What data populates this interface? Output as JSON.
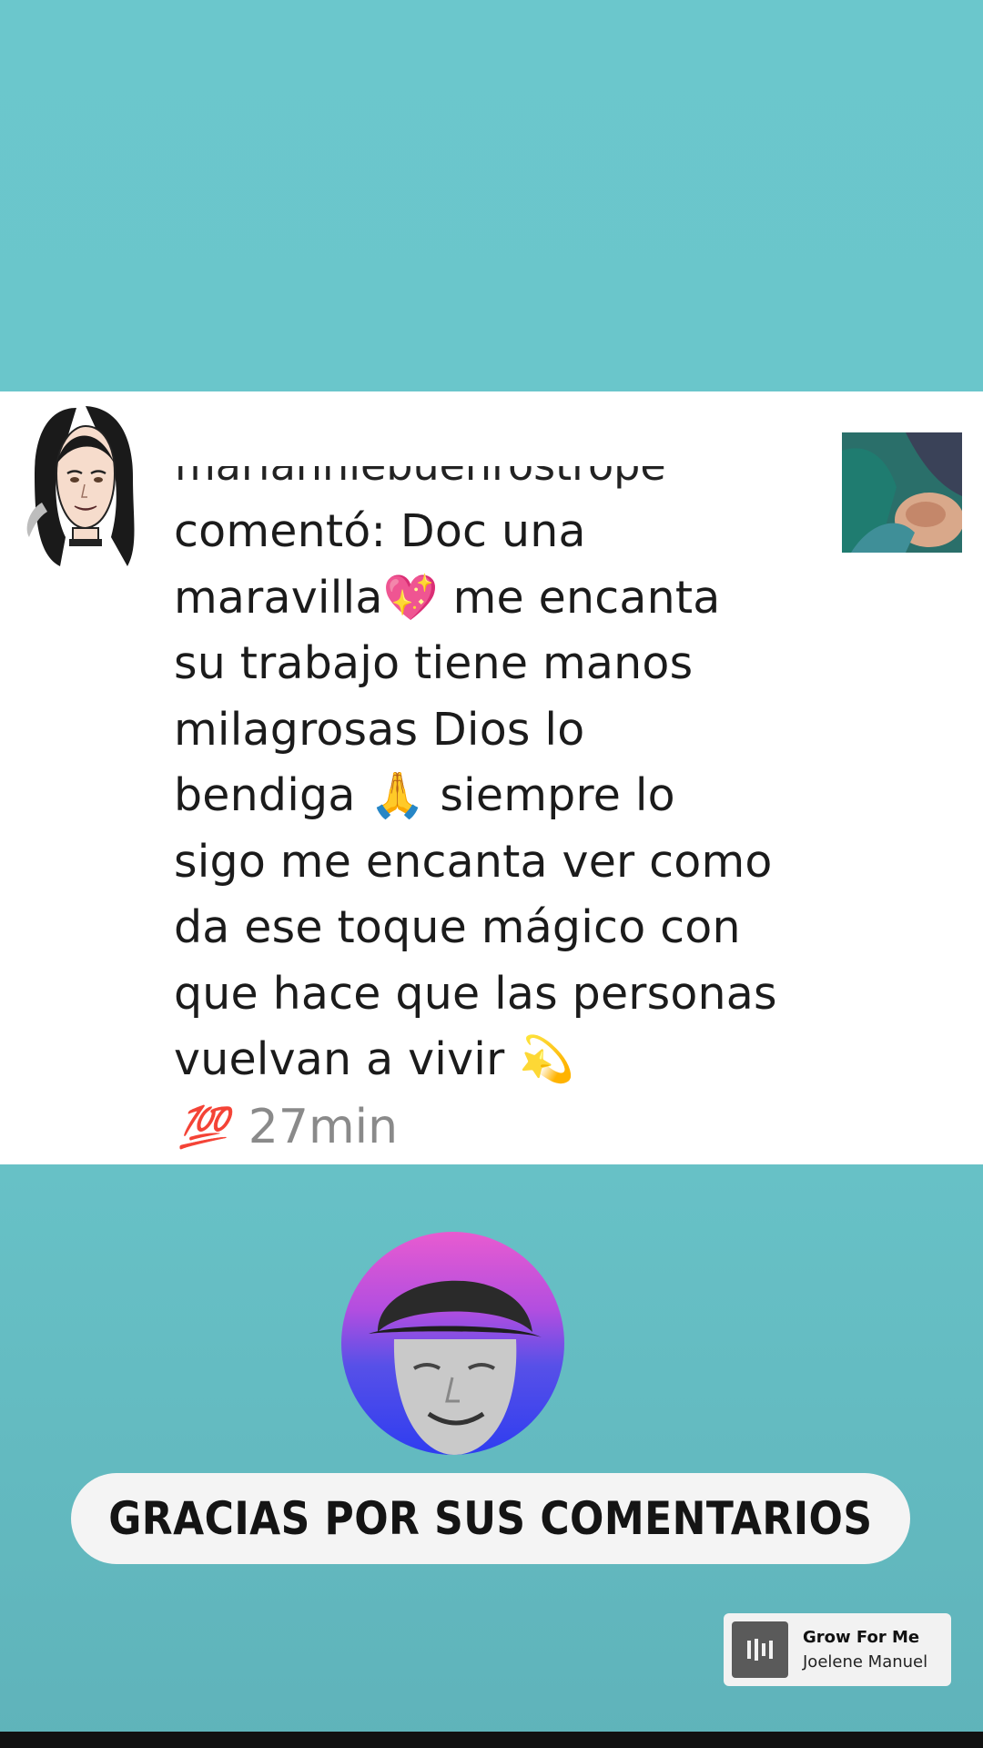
{
  "comment": {
    "clipped_username": "marianniebuenrostrope",
    "text_lines": [
      "comentó: Doc una",
      "maravilla💖  me encanta",
      "su trabajo tiene manos",
      "milagrosas Dios lo",
      "bendiga 🙏  siempre lo",
      "sigo me encanta ver como",
      "da ese toque mágico con",
      "que hace que las personas",
      "vuelvan a vivir 💫"
    ],
    "reaction_emoji": "💯",
    "timestamp": "27min"
  },
  "banner": {
    "text": "GRACIAS POR SUS COMENTARIOS"
  },
  "music": {
    "title": "Grow For Me",
    "artist": "Joelene Manuel",
    "icon": "music-sticker-icon"
  },
  "colors": {
    "background": "#6bc6ca",
    "card": "#ffffff",
    "timestamp": "#8a8a8a",
    "banner": "#f4f4f4"
  }
}
